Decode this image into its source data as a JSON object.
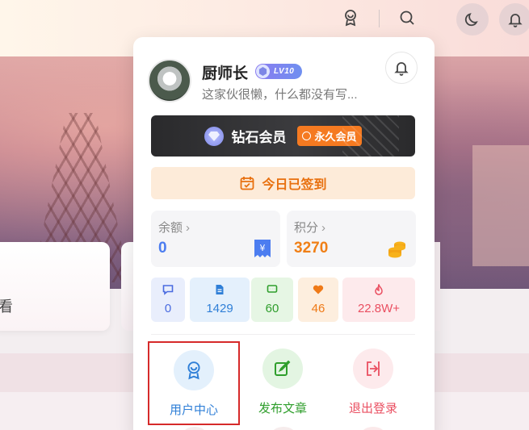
{
  "background": {
    "card_text": "看"
  },
  "header": {
    "icons": [
      "badge-icon",
      "search-icon",
      "moon-icon",
      "bell-icon"
    ]
  },
  "user": {
    "name": "厨师长",
    "level": "LV10",
    "bio": "这家伙很懒，什么都没有写..."
  },
  "vip": {
    "title": "钻石会员",
    "tag": "永久会员"
  },
  "checkin": {
    "label": "今日已签到"
  },
  "stats": {
    "balance_label": "余额",
    "balance_value": "0",
    "points_label": "积分",
    "points_value": "3270"
  },
  "counts": [
    {
      "icon": "comment-icon",
      "value": "0"
    },
    {
      "icon": "document-icon",
      "value": "1429"
    },
    {
      "icon": "message-icon",
      "value": "60"
    },
    {
      "icon": "heart-icon",
      "value": "46"
    },
    {
      "icon": "fire-icon",
      "value": "22.8W+"
    }
  ],
  "nav": [
    {
      "label": "用户中心",
      "icon": "user-badge-icon"
    },
    {
      "label": "发布文章",
      "icon": "edit-icon"
    },
    {
      "label": "退出登录",
      "icon": "logout-icon"
    }
  ],
  "colors": {
    "accent_orange": "#f07f16",
    "accent_blue": "#4c7df0",
    "accent_green": "#2f9e2c",
    "accent_red": "#ea4f61",
    "highlight_border": "#d62a2a"
  }
}
